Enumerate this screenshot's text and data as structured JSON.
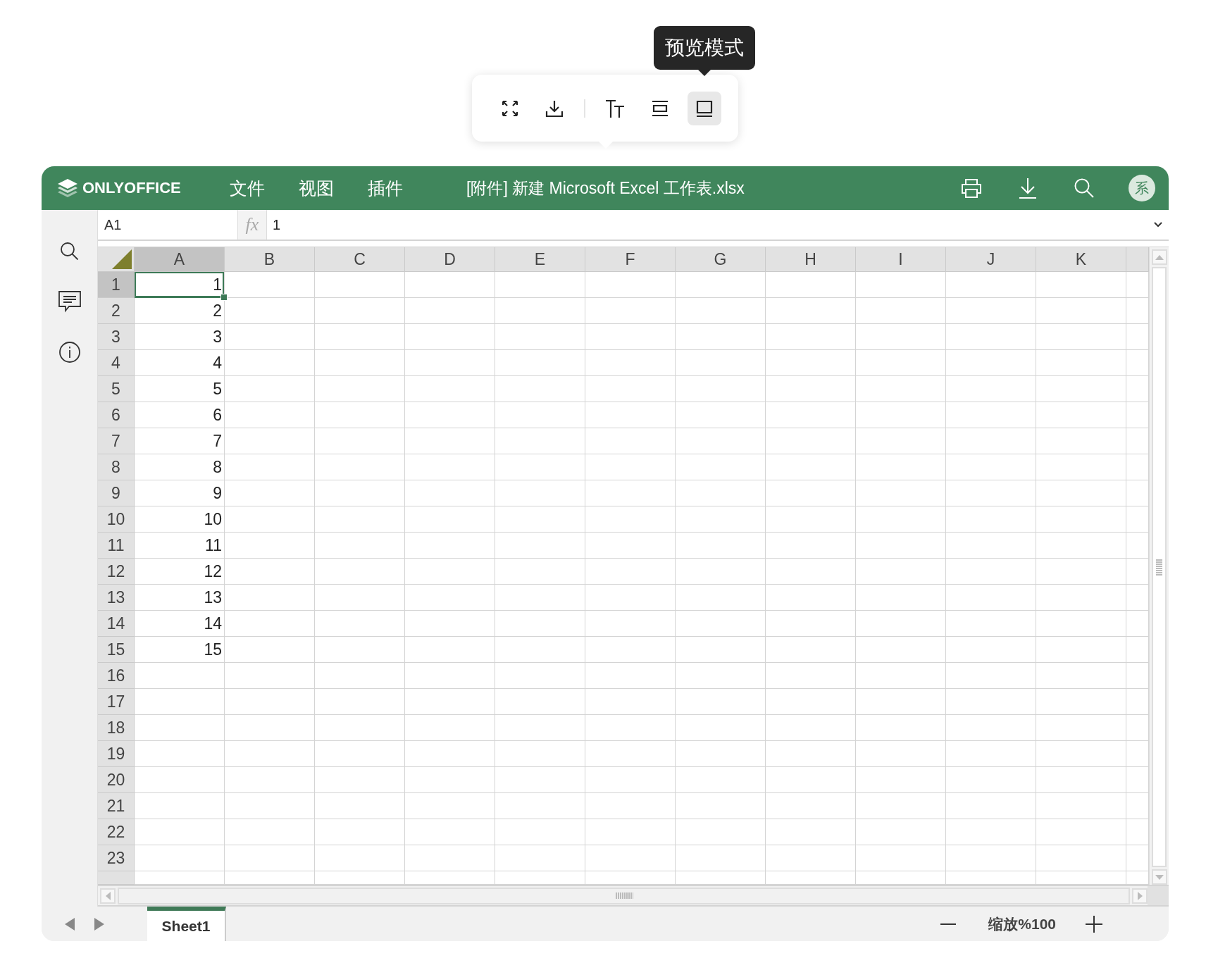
{
  "preview_toolbar": {
    "buttons": [
      {
        "kind": "fullscreen",
        "selected": false
      },
      {
        "kind": "download",
        "selected": false
      },
      {
        "kind": "separator"
      },
      {
        "kind": "text-size",
        "selected": false
      },
      {
        "kind": "fit",
        "selected": false
      },
      {
        "kind": "preview",
        "selected": true
      }
    ],
    "tooltip": "预览模式"
  },
  "header": {
    "logo": "ONLYOFFICE",
    "menu": [
      "文件",
      "视图",
      "插件"
    ],
    "title": "[附件] 新建 Microsoft Excel 工作表.xlsx",
    "avatar": "系"
  },
  "formula_bar": {
    "name_box": "A1",
    "fx": "fx",
    "value": "1"
  },
  "sheet": {
    "columns": [
      {
        "label": "A",
        "selected": true
      },
      {
        "label": "B",
        "selected": false
      },
      {
        "label": "C",
        "selected": false
      },
      {
        "label": "D",
        "selected": false
      },
      {
        "label": "E",
        "selected": false
      },
      {
        "label": "F",
        "selected": false
      },
      {
        "label": "G",
        "selected": false
      },
      {
        "label": "H",
        "selected": false
      },
      {
        "label": "I",
        "selected": false
      },
      {
        "label": "J",
        "selected": false
      },
      {
        "label": "K",
        "selected": false
      }
    ],
    "rows": [
      {
        "label": "1",
        "selected": true,
        "cells": [
          "1"
        ]
      },
      {
        "label": "2",
        "selected": false,
        "cells": [
          "2"
        ]
      },
      {
        "label": "3",
        "selected": false,
        "cells": [
          "3"
        ]
      },
      {
        "label": "4",
        "selected": false,
        "cells": [
          "4"
        ]
      },
      {
        "label": "5",
        "selected": false,
        "cells": [
          "5"
        ]
      },
      {
        "label": "6",
        "selected": false,
        "cells": [
          "6"
        ]
      },
      {
        "label": "7",
        "selected": false,
        "cells": [
          "7"
        ]
      },
      {
        "label": "8",
        "selected": false,
        "cells": [
          "8"
        ]
      },
      {
        "label": "9",
        "selected": false,
        "cells": [
          "9"
        ]
      },
      {
        "label": "10",
        "selected": false,
        "cells": [
          "10"
        ]
      },
      {
        "label": "11",
        "selected": false,
        "cells": [
          "11"
        ]
      },
      {
        "label": "12",
        "selected": false,
        "cells": [
          "12"
        ]
      },
      {
        "label": "13",
        "selected": false,
        "cells": [
          "13"
        ]
      },
      {
        "label": "14",
        "selected": false,
        "cells": [
          "14"
        ]
      },
      {
        "label": "15",
        "selected": false,
        "cells": [
          "15"
        ]
      },
      {
        "label": "16",
        "selected": false,
        "cells": []
      },
      {
        "label": "17",
        "selected": false,
        "cells": []
      },
      {
        "label": "18",
        "selected": false,
        "cells": []
      },
      {
        "label": "19",
        "selected": false,
        "cells": []
      },
      {
        "label": "20",
        "selected": false,
        "cells": []
      },
      {
        "label": "21",
        "selected": false,
        "cells": []
      },
      {
        "label": "22",
        "selected": false,
        "cells": []
      },
      {
        "label": "23",
        "selected": false,
        "cells": []
      }
    ]
  },
  "status_bar": {
    "sheet_tabs": [
      {
        "label": "Sheet1",
        "selected": true
      }
    ],
    "zoom": "缩放%100"
  }
}
